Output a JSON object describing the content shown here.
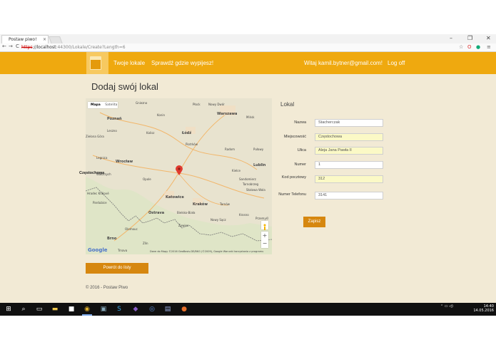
{
  "browser": {
    "tab_title": "Postaw piwo!",
    "tab_close": "×",
    "url_insecure": "https",
    "url_host": "://localhost",
    "url_path": ":44300/Lokale/Create?Length=6",
    "back": "←",
    "forward": "→",
    "reload": "C",
    "win_min": "–",
    "win_max": "❐",
    "win_close": "✕"
  },
  "navbar": {
    "links": [
      "Twoje lokale",
      "Sprawdź gdzie wypijesz!"
    ],
    "greeting": "Witaj kamil.bytner@gmail.com!",
    "logoff": "Log off"
  },
  "page": {
    "heading": "Dodaj swój lokal",
    "form_title": "Lokal",
    "fields": [
      {
        "label": "Nazwa",
        "value": "Stacherczak",
        "highlight": false
      },
      {
        "label": "Miejscowość",
        "value": "Częstochowa",
        "highlight": true
      },
      {
        "label": "Ulica",
        "value": "Aleja Jana Pawła II",
        "highlight": true
      },
      {
        "label": "Numer",
        "value": "1",
        "highlight": false
      },
      {
        "label": "Kod pocztowy",
        "value": "312",
        "highlight": true
      },
      {
        "label": "Numer Telefonu",
        "value": "3141",
        "highlight": false
      }
    ],
    "save_label": "Zapisz",
    "back_label": "Powrót do listy",
    "footer": "© 2016 - Postaw Piwo"
  },
  "map": {
    "tab_map": "Mapa",
    "tab_satellite": "Satelita",
    "google": "Google",
    "attribution": "Dane do Mapy ©2016 GeoBasis-DE/BKG (©2009), Google    Warunki korzystania z programu",
    "zoom_in": "+",
    "zoom_out": "−",
    "marker_city": "Częstochowa",
    "cities": [
      "Gniezno",
      "Nowy Dwór Mazowiecki",
      "Warszawa",
      "Poznań",
      "Konin",
      "Płock",
      "Mińsk Mazowiecki",
      "Leszno",
      "Kalisz",
      "Łódź",
      "Zielona Góra",
      "Piotrków Trybunalski",
      "Radom",
      "Puławy",
      "Legnica",
      "Wrocław",
      "Wałbrzych",
      "Opole",
      "Kielce",
      "Lublin",
      "Zamość",
      "Sandomierz",
      "Hradec Králové",
      "Pardubice",
      "Katowice",
      "Kraków",
      "Tarnów",
      "Ostrava",
      "Bielsko-Biała",
      "Nowy Sącz",
      "Krosno",
      "Przemyśl",
      "Brno",
      "Olomouc",
      "Zlín",
      "Trnava",
      "Stalowa Wola",
      "Żywiec",
      "Tarnobrzeg"
    ]
  },
  "taskbar": {
    "time": "14:40",
    "date": "14.05.2016"
  },
  "colors": {
    "navbar": "#efa90f",
    "page_bg": "#f2ead5",
    "button": "#d6870f",
    "highlight_input": "#fbf9c6",
    "taskbar": "#101010"
  }
}
